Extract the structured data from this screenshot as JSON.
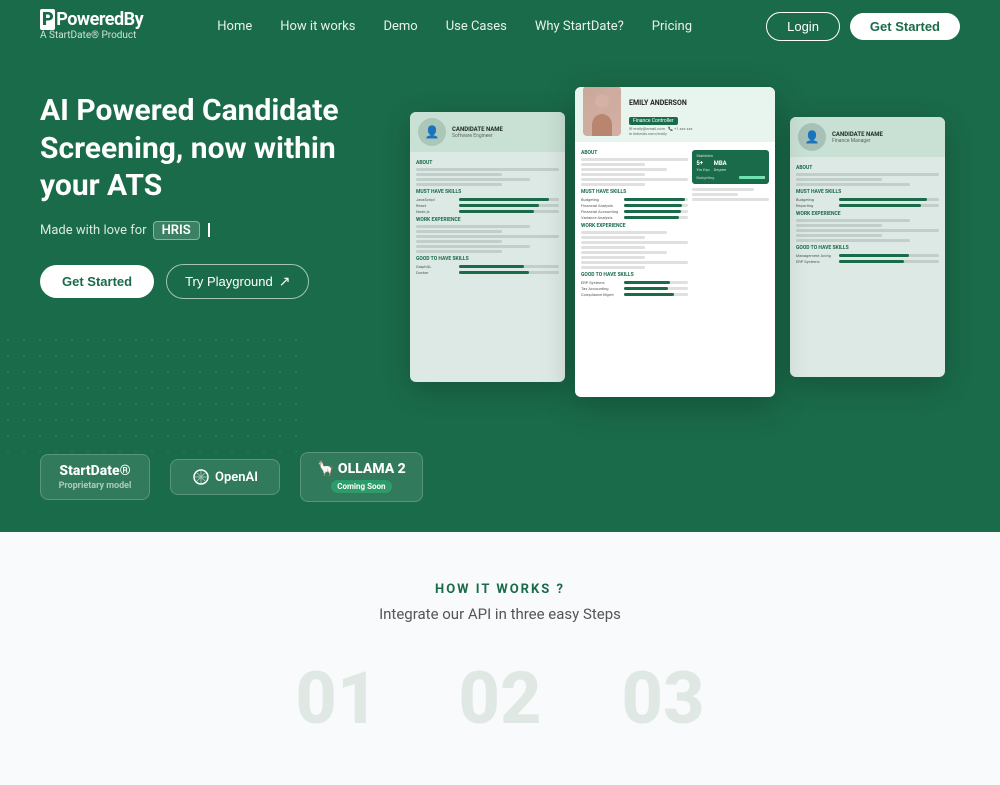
{
  "nav": {
    "logo": {
      "powered_by": "PoweredBy",
      "sub": "A StartDate® Product"
    },
    "links": [
      "Home",
      "How it works",
      "Demo",
      "Use Cases",
      "Why StartDate?",
      "Pricing"
    ],
    "login": "Login",
    "get_started": "Get Started"
  },
  "hero": {
    "title": "AI Powered Candidate Screening, now within your ATS",
    "made_with_love": "Made with love for",
    "hris_badge": "HRIS",
    "btn_get_started": "Get Started",
    "btn_playground": "Try Playground",
    "arrow": "↗"
  },
  "partners": [
    {
      "name": "StartDate®",
      "sub": "Proprietary model",
      "coming_soon": false
    },
    {
      "name": "OpenAI",
      "sub": "",
      "coming_soon": false
    },
    {
      "name": "OLLAMA 2",
      "sub": "",
      "coming_soon": true
    }
  ],
  "how_it_works": {
    "tag": "HOW IT WORKS ?",
    "subtitle": "Integrate our API in three easy Steps",
    "steps": [
      "01",
      "02",
      "03"
    ]
  },
  "resume_center": {
    "name": "EMILY ANDERSON",
    "role": "Finance Controller",
    "sections": [
      "About",
      "Statistics",
      "Must Have Skills",
      "Work Experience",
      "Good to Have Skills"
    ]
  }
}
